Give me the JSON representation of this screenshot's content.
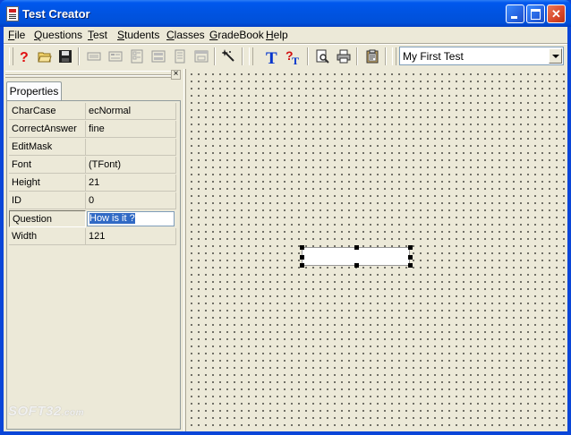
{
  "window": {
    "title": "Test Creator",
    "min_label": "_",
    "max_label": "□",
    "close_label": "✕"
  },
  "menu": {
    "items": [
      {
        "acc": "F",
        "rest": "ile"
      },
      {
        "acc": "Q",
        "rest": "uestions"
      },
      {
        "acc": "T",
        "rest": "est"
      },
      {
        "acc": "S",
        "rest": "tudents"
      },
      {
        "acc": "C",
        "rest": "lasses"
      },
      {
        "acc": "G",
        "rest": "radeBook"
      },
      {
        "acc": "H",
        "rest": "elp"
      }
    ]
  },
  "toolbar": {
    "icons": [
      "help-icon",
      "open-folder-icon",
      "save-icon",
      "layout-1-icon",
      "layout-2-icon",
      "layout-3-icon",
      "layout-4-icon",
      "layout-5-icon",
      "layout-6-icon",
      "magic-wand-icon",
      "text-tool-icon",
      "question-text-icon",
      "print-preview-icon",
      "print-icon",
      "clipboard-icon"
    ],
    "test_select": "My First Test"
  },
  "panel": {
    "close_label": "×",
    "tab_label": "Properties",
    "properties": [
      {
        "name": "CharCase",
        "value": "ecNormal"
      },
      {
        "name": "CorrectAnswer",
        "value": "fine"
      },
      {
        "name": "EditMask",
        "value": ""
      },
      {
        "name": "Font",
        "value": "(TFont)"
      },
      {
        "name": "Height",
        "value": "21"
      },
      {
        "name": "ID",
        "value": "0"
      },
      {
        "name": "Question",
        "value": "How is it ?"
      },
      {
        "name": "Width",
        "value": "121"
      }
    ]
  },
  "watermark": {
    "text": "SOFT32",
    "suffix": ".com"
  },
  "colors": {
    "titlebar": "#0054e3",
    "selection": "#316ac5",
    "face": "#ece9d8"
  }
}
